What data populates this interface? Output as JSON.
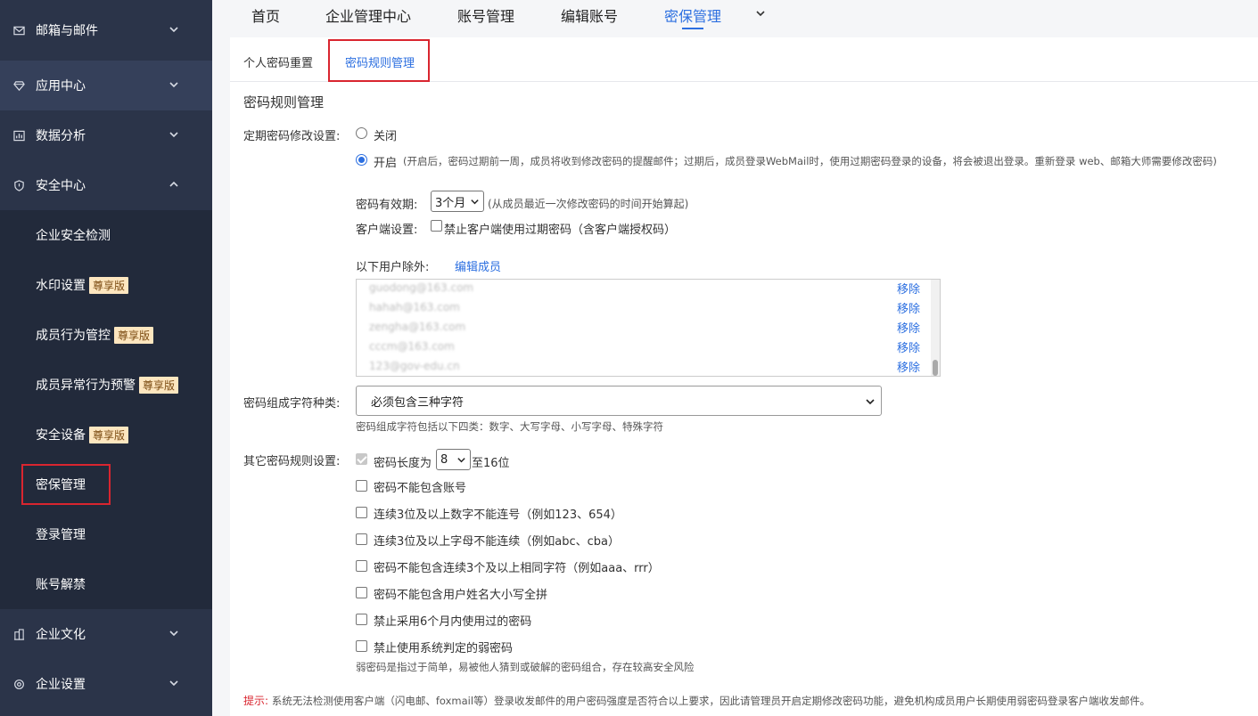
{
  "sidebar": {
    "groups": {
      "mail": "邮箱与邮件",
      "apps": "应用中心",
      "analytics": "数据分析",
      "security": "安全中心",
      "culture": "企业文化",
      "settings": "企业设置"
    },
    "security_items": [
      {
        "label": "企业安全检测",
        "badge": ""
      },
      {
        "label": "水印设置",
        "badge": "尊享版"
      },
      {
        "label": "成员行为管控",
        "badge": "尊享版"
      },
      {
        "label": "成员异常行为预警",
        "badge": "尊享版"
      },
      {
        "label": "安全设备",
        "badge": "尊享版"
      },
      {
        "label": "密保管理",
        "badge": ""
      },
      {
        "label": "登录管理",
        "badge": ""
      },
      {
        "label": "账号解禁",
        "badge": ""
      }
    ]
  },
  "topnav": {
    "items": [
      "首页",
      "企业管理中心",
      "账号管理",
      "编辑账号",
      "密保管理"
    ],
    "active_index": 4
  },
  "subtabs": {
    "personal_reset": "个人密码重置",
    "rule_manage": "密码规则管理"
  },
  "section": {
    "title": "密码规则管理",
    "periodic_label": "定期密码修改设置:",
    "option_off": "关闭",
    "option_on": "开启",
    "option_on_desc": "(开启后，密码过期前一周，成员将收到修改密码的提醒邮件；过期后，成员登录WebMail时，使用过期密码登录的设备，将会被退出登录。重新登录 web、邮箱大师需要修改密码)",
    "validity_label": "密码有效期:",
    "validity_value": "3个月",
    "validity_hint": "(从成员最近一次修改密码的时间开始算起)",
    "client_label": "客户端设置:",
    "client_option": "禁止客户端使用过期密码（含客户端授权码）",
    "exclude_label": "以下用户除外:",
    "edit_members": "编辑成员",
    "excluded_users": [
      {
        "email": "guodong@163.com",
        "action": "移除"
      },
      {
        "email": "hahah@163.com",
        "action": "移除"
      },
      {
        "email": "zengha@163.com",
        "action": "移除"
      },
      {
        "email": "cccm@163.com",
        "action": "移除"
      },
      {
        "email": "123@gov-edu.cn",
        "action": "移除"
      }
    ],
    "charset_label": "密码组成字符种类:",
    "charset_value": "必须包含三种字符",
    "charset_hint": "密码组成字符包括以下四类：数字、大写字母、小写字母、特殊字符",
    "other_label": "其它密码规则设置:",
    "length_prefix": "密码长度为",
    "length_value": "8",
    "length_suffix": "至16位",
    "rules": [
      "密码不能包含账号",
      "连续3位及以上数字不能连号（例如123、654）",
      "连续3位及以上字母不能连续（例如abc、cba）",
      "密码不能包含连续3个及以上相同字符（例如aaa、rrr）",
      "密码不能包含用户姓名大小写全拼",
      "禁止采用6个月内使用过的密码",
      "禁止使用系统判定的弱密码"
    ],
    "weak_hint": "弱密码是指过于简单，易被他人猜到或破解的密码组合，存在较高安全风险",
    "tip_label": "提示:",
    "tip_text": "系统无法检测使用客户端（闪电邮、foxmail等）登录收发邮件的用户密码强度是否符合以上要求，因此请管理员开启定期修改密码功能，避免机构成员用户长期使用弱密码登录客户端收发邮件。"
  },
  "colors": {
    "sidebar_bg": "#2b3449",
    "sidebar_sub_bg": "#222a3b",
    "accent": "#2c6fe0",
    "highlight_box": "#d9252f",
    "badge_bg": "#fde6bf"
  }
}
